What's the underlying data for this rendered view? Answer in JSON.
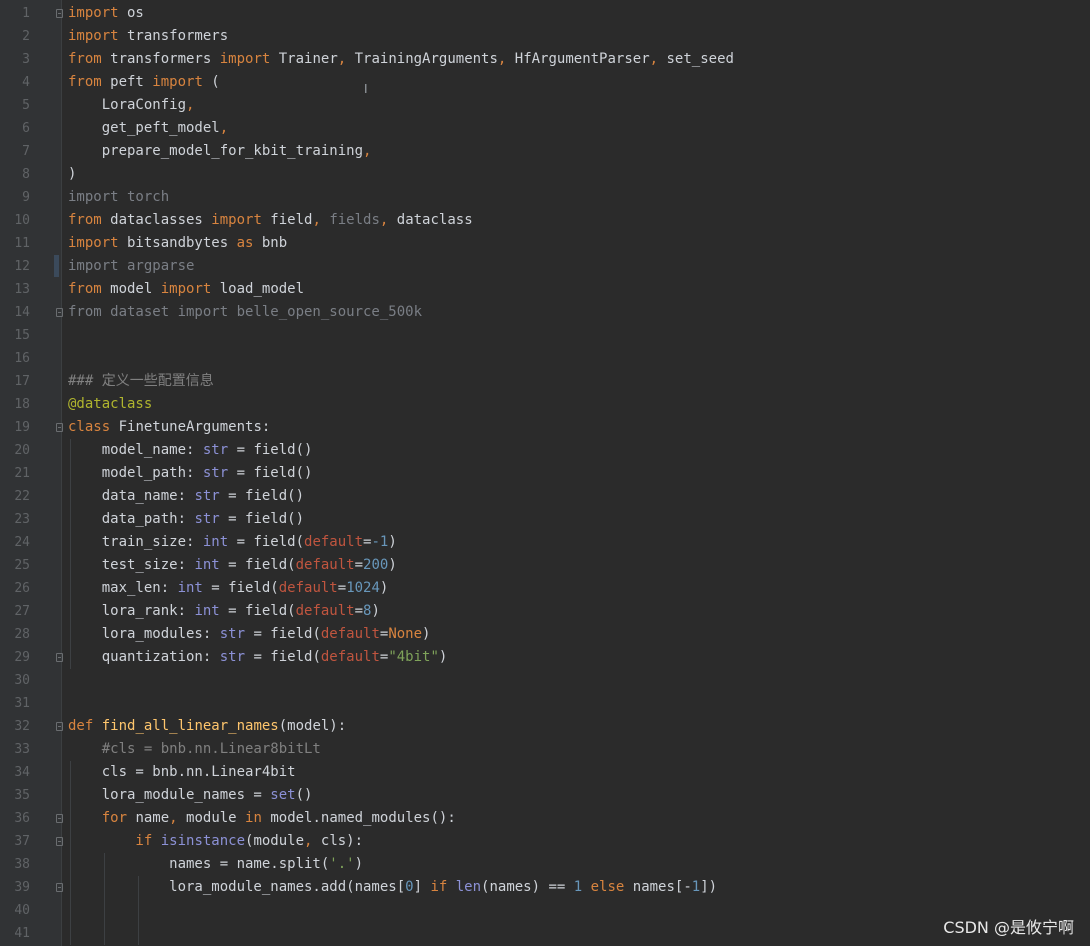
{
  "editor": {
    "lines": [
      {
        "n": "1",
        "fold": true,
        "t": [
          [
            "kw",
            "import"
          ],
          [
            "nm",
            " os"
          ]
        ]
      },
      {
        "n": "2",
        "t": [
          [
            "kw",
            "import"
          ],
          [
            "nm",
            " transformers"
          ]
        ]
      },
      {
        "n": "3",
        "t": [
          [
            "kw",
            "from"
          ],
          [
            "nm",
            " transformers "
          ],
          [
            "kw",
            "import"
          ],
          [
            "nm",
            " Trainer"
          ],
          [
            "kw",
            ","
          ],
          [
            "nm",
            " TrainingArguments"
          ],
          [
            "kw",
            ","
          ],
          [
            "nm",
            " HfArgumentParser"
          ],
          [
            "kw",
            ","
          ],
          [
            "nm",
            " set_seed"
          ]
        ]
      },
      {
        "n": "4",
        "t": [
          [
            "kw",
            "from"
          ],
          [
            "nm",
            " peft "
          ],
          [
            "kw",
            "import"
          ],
          [
            "nm",
            " ("
          ]
        ]
      },
      {
        "n": "5",
        "t": [
          [
            "nm",
            "    LoraConfig"
          ],
          [
            "kw",
            ","
          ]
        ]
      },
      {
        "n": "6",
        "t": [
          [
            "nm",
            "    get_peft_model"
          ],
          [
            "kw",
            ","
          ]
        ]
      },
      {
        "n": "7",
        "t": [
          [
            "nm",
            "    prepare_model_for_kbit_training"
          ],
          [
            "kw",
            ","
          ]
        ]
      },
      {
        "n": "8",
        "t": [
          [
            "nm",
            ")"
          ]
        ]
      },
      {
        "n": "9",
        "t": [
          [
            "gy",
            "import torch"
          ]
        ]
      },
      {
        "n": "10",
        "t": [
          [
            "kw",
            "from"
          ],
          [
            "nm",
            " dataclasses "
          ],
          [
            "kw",
            "import"
          ],
          [
            "nm",
            " field"
          ],
          [
            "kw",
            ","
          ],
          [
            "gy",
            " fields"
          ],
          [
            "kw",
            ","
          ],
          [
            "nm",
            " dataclass"
          ]
        ]
      },
      {
        "n": "11",
        "t": [
          [
            "kw",
            "import"
          ],
          [
            "nm",
            " bitsandbytes "
          ],
          [
            "kw",
            "as"
          ],
          [
            "nm",
            " bnb"
          ]
        ]
      },
      {
        "n": "12",
        "t": [
          [
            "gy",
            "import argparse"
          ]
        ]
      },
      {
        "n": "13",
        "t": [
          [
            "kw",
            "from"
          ],
          [
            "nm",
            " model "
          ],
          [
            "kw",
            "import"
          ],
          [
            "nm",
            " load_model"
          ]
        ]
      },
      {
        "n": "14",
        "fold": true,
        "t": [
          [
            "gy",
            "from dataset import belle_open_source_500k"
          ]
        ]
      },
      {
        "n": "15",
        "t": []
      },
      {
        "n": "16",
        "t": []
      },
      {
        "n": "17",
        "t": [
          [
            "cm",
            "### 定义一些配置信息"
          ]
        ]
      },
      {
        "n": "18",
        "t": [
          [
            "dc",
            "@dataclass"
          ]
        ]
      },
      {
        "n": "19",
        "fold": true,
        "t": [
          [
            "kw",
            "class"
          ],
          [
            "nm",
            " FinetuneArguments:"
          ]
        ]
      },
      {
        "n": "20",
        "t": [
          [
            "nm",
            "    model_name: "
          ],
          [
            "bi",
            "str"
          ],
          [
            "nm",
            " = field()"
          ]
        ]
      },
      {
        "n": "21",
        "t": [
          [
            "nm",
            "    model_path: "
          ],
          [
            "bi",
            "str"
          ],
          [
            "nm",
            " = field()"
          ]
        ]
      },
      {
        "n": "22",
        "t": [
          [
            "nm",
            "    data_name: "
          ],
          [
            "bi",
            "str"
          ],
          [
            "nm",
            " = field()"
          ]
        ]
      },
      {
        "n": "23",
        "t": [
          [
            "nm",
            "    data_path: "
          ],
          [
            "bi",
            "str"
          ],
          [
            "nm",
            " = field()"
          ]
        ]
      },
      {
        "n": "24",
        "t": [
          [
            "nm",
            "    train_size: "
          ],
          [
            "bi",
            "int"
          ],
          [
            "nm",
            " = field("
          ],
          [
            "pa",
            "default"
          ],
          [
            "nm",
            "="
          ],
          [
            "nu",
            "-1"
          ],
          [
            "nm",
            ")"
          ]
        ]
      },
      {
        "n": "25",
        "t": [
          [
            "nm",
            "    test_size: "
          ],
          [
            "bi",
            "int"
          ],
          [
            "nm",
            " = field("
          ],
          [
            "pa",
            "default"
          ],
          [
            "nm",
            "="
          ],
          [
            "nu",
            "200"
          ],
          [
            "nm",
            ")"
          ]
        ]
      },
      {
        "n": "26",
        "t": [
          [
            "nm",
            "    max_len: "
          ],
          [
            "bi",
            "int"
          ],
          [
            "nm",
            " = field("
          ],
          [
            "pa",
            "default"
          ],
          [
            "nm",
            "="
          ],
          [
            "nu",
            "1024"
          ],
          [
            "nm",
            ")"
          ]
        ]
      },
      {
        "n": "27",
        "t": [
          [
            "nm",
            "    lora_rank: "
          ],
          [
            "bi",
            "int"
          ],
          [
            "nm",
            " = field("
          ],
          [
            "pa",
            "default"
          ],
          [
            "nm",
            "="
          ],
          [
            "nu",
            "8"
          ],
          [
            "nm",
            ")"
          ]
        ]
      },
      {
        "n": "28",
        "t": [
          [
            "nm",
            "    lora_modules: "
          ],
          [
            "bi",
            "str"
          ],
          [
            "nm",
            " = field("
          ],
          [
            "pa",
            "default"
          ],
          [
            "nm",
            "="
          ],
          [
            "cn",
            "None"
          ],
          [
            "nm",
            ")"
          ]
        ]
      },
      {
        "n": "29",
        "fold": true,
        "t": [
          [
            "nm",
            "    quantization: "
          ],
          [
            "bi",
            "str"
          ],
          [
            "nm",
            " = field("
          ],
          [
            "pa",
            "default"
          ],
          [
            "nm",
            "="
          ],
          [
            "st",
            "\"4bit\""
          ],
          [
            "nm",
            ")"
          ]
        ]
      },
      {
        "n": "30",
        "t": []
      },
      {
        "n": "31",
        "t": []
      },
      {
        "n": "32",
        "fold": true,
        "t": [
          [
            "kw",
            "def"
          ],
          [
            "fn",
            " find_all_linear_names"
          ],
          [
            "nm",
            "(model):"
          ]
        ]
      },
      {
        "n": "33",
        "t": [
          [
            "cm",
            "    #cls = bnb.nn.Linear8bitLt"
          ]
        ]
      },
      {
        "n": "34",
        "t": [
          [
            "nm",
            "    cls = bnb.nn.Linear4bit"
          ]
        ]
      },
      {
        "n": "35",
        "t": [
          [
            "nm",
            "    lora_module_names = "
          ],
          [
            "bi",
            "set"
          ],
          [
            "nm",
            "()"
          ]
        ]
      },
      {
        "n": "36",
        "fold": true,
        "t": [
          [
            "kw",
            "    for"
          ],
          [
            "nm",
            " name"
          ],
          [
            "kw",
            ","
          ],
          [
            "nm",
            " module "
          ],
          [
            "kw",
            "in"
          ],
          [
            "nm",
            " model.named_modules():"
          ]
        ]
      },
      {
        "n": "37",
        "fold": true,
        "t": [
          [
            "kw",
            "        if"
          ],
          [
            "bi",
            " isinstance"
          ],
          [
            "nm",
            "(module"
          ],
          [
            "kw",
            ","
          ],
          [
            "nm",
            " cls):"
          ]
        ]
      },
      {
        "n": "38",
        "t": [
          [
            "nm",
            "            names = name.split("
          ],
          [
            "st",
            "'.'"
          ],
          [
            "nm",
            ")"
          ]
        ]
      },
      {
        "n": "39",
        "fold": true,
        "t": [
          [
            "nm",
            "            lora_module_names.add(names["
          ],
          [
            "nu",
            "0"
          ],
          [
            "nm",
            "] "
          ],
          [
            "kw",
            "if"
          ],
          [
            "bi",
            " len"
          ],
          [
            "nm",
            "(names) == "
          ],
          [
            "nu",
            "1"
          ],
          [
            "kw",
            " else"
          ],
          [
            "nm",
            " names[-"
          ],
          [
            "nu",
            "1"
          ],
          [
            "nm",
            "])"
          ]
        ]
      },
      {
        "n": "40",
        "t": []
      },
      {
        "n": "41",
        "t": []
      }
    ]
  },
  "cursor": {
    "text_cursor_glyph": "I"
  },
  "watermark": {
    "text": "CSDN @是攸宁啊"
  }
}
